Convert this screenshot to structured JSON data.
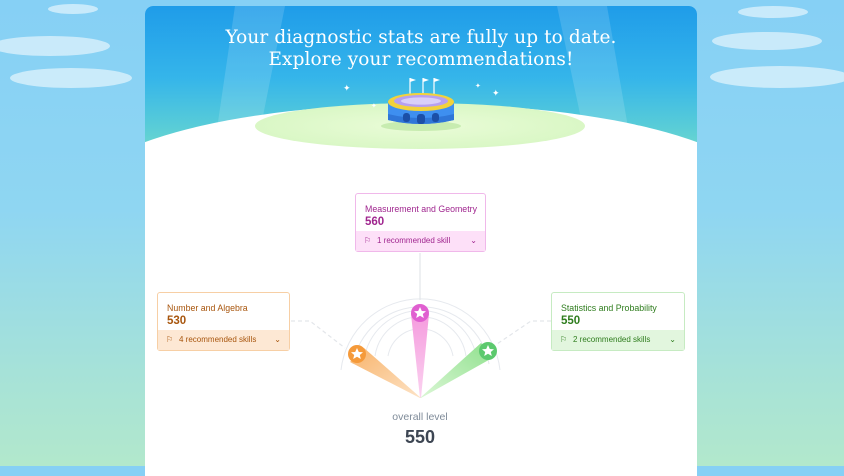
{
  "header": {
    "line1": "Your diagnostic stats are fully up to date.",
    "line2": "Explore your recommendations!"
  },
  "domains": [
    {
      "name": "Measurement and Geometry",
      "score": "560",
      "recommendation": "1 recommended skill",
      "color": "#e05fd0"
    },
    {
      "name": "Number and Algebra",
      "score": "530",
      "recommendation": "4 recommended skills",
      "color": "#f59a3a"
    },
    {
      "name": "Statistics and Probability",
      "score": "550",
      "recommendation": "2 recommended skills",
      "color": "#5cc96e"
    }
  ],
  "overall": {
    "label": "overall level",
    "value": "550"
  },
  "icons": {
    "star": "star-icon",
    "recommend": "recommend-flag-icon",
    "expand": "chevron-down-icon",
    "illustration": "stadium-icon"
  }
}
